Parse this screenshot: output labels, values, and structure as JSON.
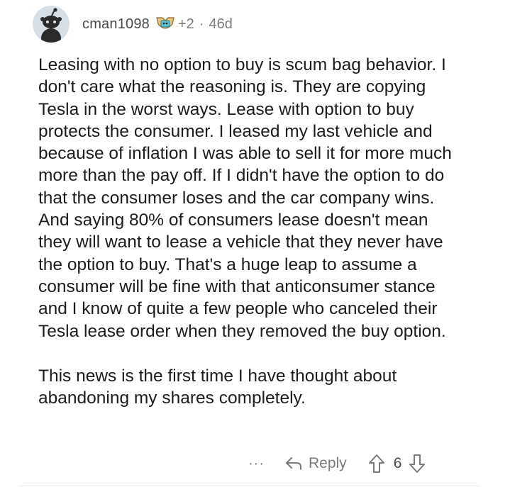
{
  "comment": {
    "author": "cman1098",
    "badge_icon": "achievement-trophy-icon",
    "badge_count": "+2",
    "separator": "·",
    "age": "46d",
    "paragraphs": [
      "Leasing with no option to buy is scum bag behavior. I don't care what the reasoning is. They are copying Tesla in the worst ways. Lease with option to buy protects the consumer. I leased my last vehicle and because of inflation I was able to sell it for more much more than the pay off. If I didn't have the option to do that the consumer loses and the car company wins. And saying 80% of consumers lease doesn't mean they will want to lease a vehicle that they never have the option to buy. That's a huge leap to assume a consumer will be fine with that anticonsumer stance and I know of quite a few people who canceled their Tesla lease order when they removed the buy option.",
      "This news is the first time I have thought about abandoning my shares completely."
    ],
    "actions": {
      "more_label": "···",
      "reply_label": "Reply",
      "score": "6"
    }
  },
  "colors": {
    "text": "#1c1c1c",
    "meta": "#7a7a7a",
    "avatar_bg": "#d7dfe6",
    "avatar_fg": "#2b2b2b"
  }
}
